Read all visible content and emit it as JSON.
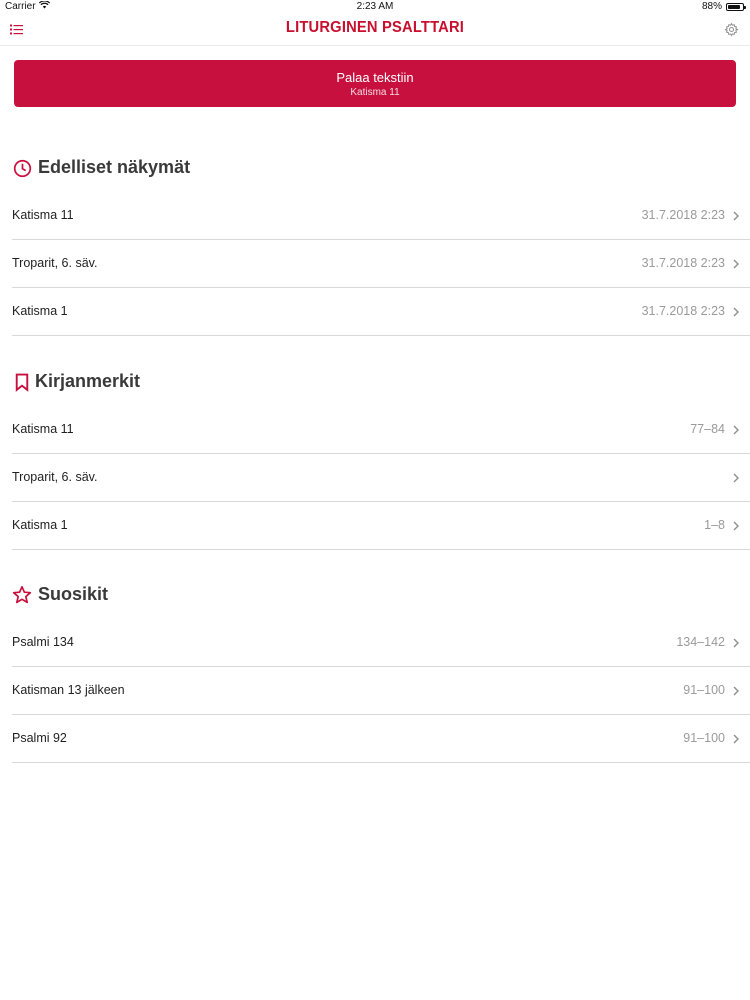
{
  "status_bar": {
    "carrier": "Carrier",
    "time": "2:23 AM",
    "battery": "88%",
    "battery_level": 0.88
  },
  "nav": {
    "title": "LITURGINEN PSALTTARI",
    "menu_icon": "list-icon",
    "settings_icon": "gear-icon"
  },
  "return_button": {
    "title": "Palaa tekstiin",
    "subtitle": "Katisma 11"
  },
  "colors": {
    "accent": "#c8103e",
    "muted_text": "#9a9a9a",
    "divider": "#d9d9d9"
  },
  "sections": [
    {
      "title": "Edelliset näkymät",
      "icon": "clock-icon",
      "rows": [
        {
          "label": "Katisma 11",
          "value": "31.7.2018 2:23"
        },
        {
          "label": "Troparit, 6. säv.",
          "value": "31.7.2018 2:23"
        },
        {
          "label": "Katisma 1",
          "value": "31.7.2018 2:23"
        }
      ]
    },
    {
      "title": "Kirjanmerkit",
      "icon": "bookmark-icon",
      "rows": [
        {
          "label": "Katisma 11",
          "value": "77–84"
        },
        {
          "label": "Troparit, 6. säv.",
          "value": ""
        },
        {
          "label": "Katisma 1",
          "value": "1–8"
        }
      ]
    },
    {
      "title": "Suosikit",
      "icon": "star-icon",
      "rows": [
        {
          "label": "Psalmi 134",
          "value": "134–142"
        },
        {
          "label": "Katisman 13 jälkeen",
          "value": "91–100"
        },
        {
          "label": "Psalmi 92",
          "value": "91–100"
        }
      ]
    }
  ]
}
